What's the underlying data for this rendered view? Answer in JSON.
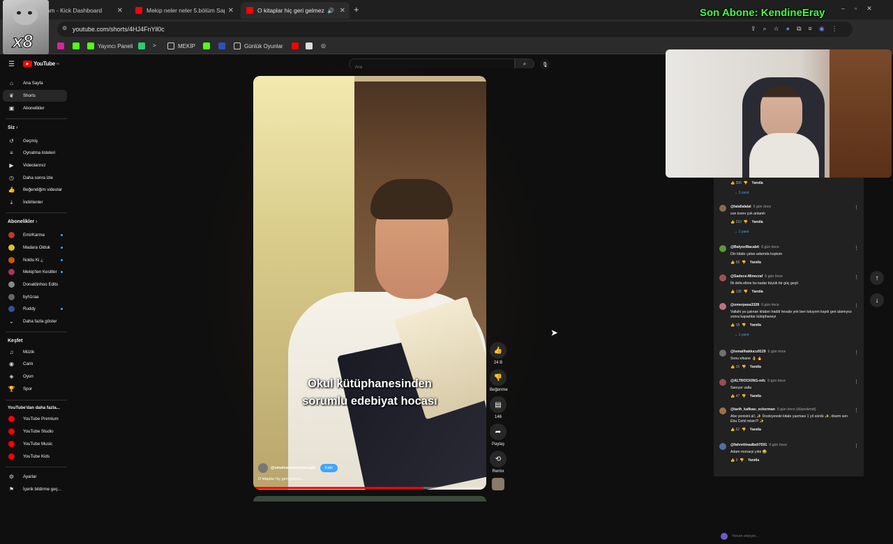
{
  "browser": {
    "tabs": [
      {
        "label": "eam - Kick Dashboard",
        "color": "#53fc18"
      },
      {
        "label": "Mekip neler neler 5.bölüm Sapı",
        "color": "#ff0000"
      },
      {
        "label": "O kitaplar hiç geri gelmez...",
        "color": "#ff0000"
      }
    ],
    "url": "youtube.com/shorts/4HJ4FnYil0c",
    "bookmarks": [
      "Yayıncı Paneli",
      "MEKİP",
      "Günlük Oyunlar"
    ]
  },
  "overlay": {
    "banner": "Son Abone: KendineEray",
    "gif_label": "x8"
  },
  "youtube": {
    "logo": "YouTube",
    "logo_sup": "TR",
    "search_placeholder": "Ara",
    "sidebar": {
      "top": [
        "Ana Sayfa",
        "Shorts",
        "Abonelikler"
      ],
      "you_header": "Siz",
      "you_items": [
        "Geçmiş",
        "Oynatma listeleri",
        "Videolarınız",
        "Daha sonra izle",
        "Beğendiğim videolar",
        "İndirilenler"
      ],
      "subs_header": "Abonelikler",
      "subs": [
        {
          "name": "EmirKarma",
          "color": "#c0392b"
        },
        {
          "name": "Madara Olduk",
          "color": "#e0c030"
        },
        {
          "name": "Noldu Ki ¿",
          "color": "#d35400"
        },
        {
          "name": "Mekip'ten Kesitler",
          "color": "#b03060"
        },
        {
          "name": "Donaldinhoo Edits",
          "color": "#888888"
        },
        {
          "name": "byh1raa",
          "color": "#666666"
        },
        {
          "name": "Ruddy",
          "color": "#3050a0"
        }
      ],
      "more_label": "Daha fazla göster",
      "explore_header": "Keşfet",
      "explore": [
        "Müzik",
        "Canlı",
        "Oyun",
        "Spor"
      ],
      "more_header": "YouTube'dan daha fazla...",
      "more_items": [
        "YouTube Premium",
        "YouTube Studio",
        "YouTube Music",
        "YouTube Kids"
      ],
      "bottom": [
        "Ayarlar",
        "İçerik bildirme geç..."
      ]
    },
    "short": {
      "caption_line1": "Okul kütüphanesinden",
      "caption_line2": "sorumlu edebiyat hocası",
      "channel": "@umutcandeniziyasoglu",
      "subscribe": "Katıl",
      "title": "O kitaplar hiç geri gelmez..."
    },
    "actions": {
      "likes": "24 B",
      "dislike_label": "Beğenme",
      "comments": "146",
      "share": "Paylaş",
      "remix": "Remix"
    },
    "comments": {
      "top_reply_count": "3 yanıt",
      "top_likes": "306",
      "reply_label": "Yanıtla",
      "input_placeholder": "Yorum ekleyin...",
      "items": [
        {
          "user": "@lalallalalal",
          "time": "6 gün önce",
          "text": "son kısmı çok anlamlı",
          "likes": "210",
          "replies": "1 yanıt",
          "color": "#8a6a4a"
        },
        {
          "user": "@BalyozMacabit",
          "time": "6 gün önce",
          "text": "Din kitabı çalan adamda koptum",
          "likes": "58",
          "replies": "",
          "color": "#5a9a3a"
        },
        {
          "user": "@Sadece-Minecraf",
          "time": "6 gün önce",
          "text": "İlk defa elime bu kadar büyük bir güç geçti",
          "likes": "135",
          "replies": "",
          "color": "#a05050"
        },
        {
          "user": "@omerpasa3328",
          "time": "6 gün önce",
          "text": "Vallahi ya çalınan kitabın haddi hesabı yok ben tutuyom kaydı geri alamıyoz sonra kapadılar kütüphaneyi",
          "likes": "18",
          "replies": "1 yanıt",
          "color": "#c07080"
        },
        {
          "user": "@ismailhakkıcu9129",
          "time": "6 gün önce",
          "text": "Sonu efsane 👌 🔥",
          "likes": "15",
          "replies": "",
          "color": "#707070"
        },
        {
          "user": "@ALTROCKING-mfc",
          "time": "6 gün önce",
          "text": "Sanıyor valla",
          "likes": "47",
          "replies": "",
          "color": "#9a4a5a"
        },
        {
          "user": "@tarih_kafkası_eckerman",
          "time": "6 gün önce (düzenlendi)",
          "text": "Abe yenisini al!, ✨ Dostoyevski kitabı yazması 1 yıl sürdü ✨, ölsem sen  Ebu Cehil misin?! ✨",
          "likes": "62",
          "replies": "",
          "color": "#a07040"
        },
        {
          "user": "@fahrettinadbeli7591",
          "time": "6 gün önce",
          "text": "Adam monaryi yıktı 😂",
          "likes": "9",
          "replies": "",
          "color": "#5070a0"
        }
      ]
    }
  }
}
